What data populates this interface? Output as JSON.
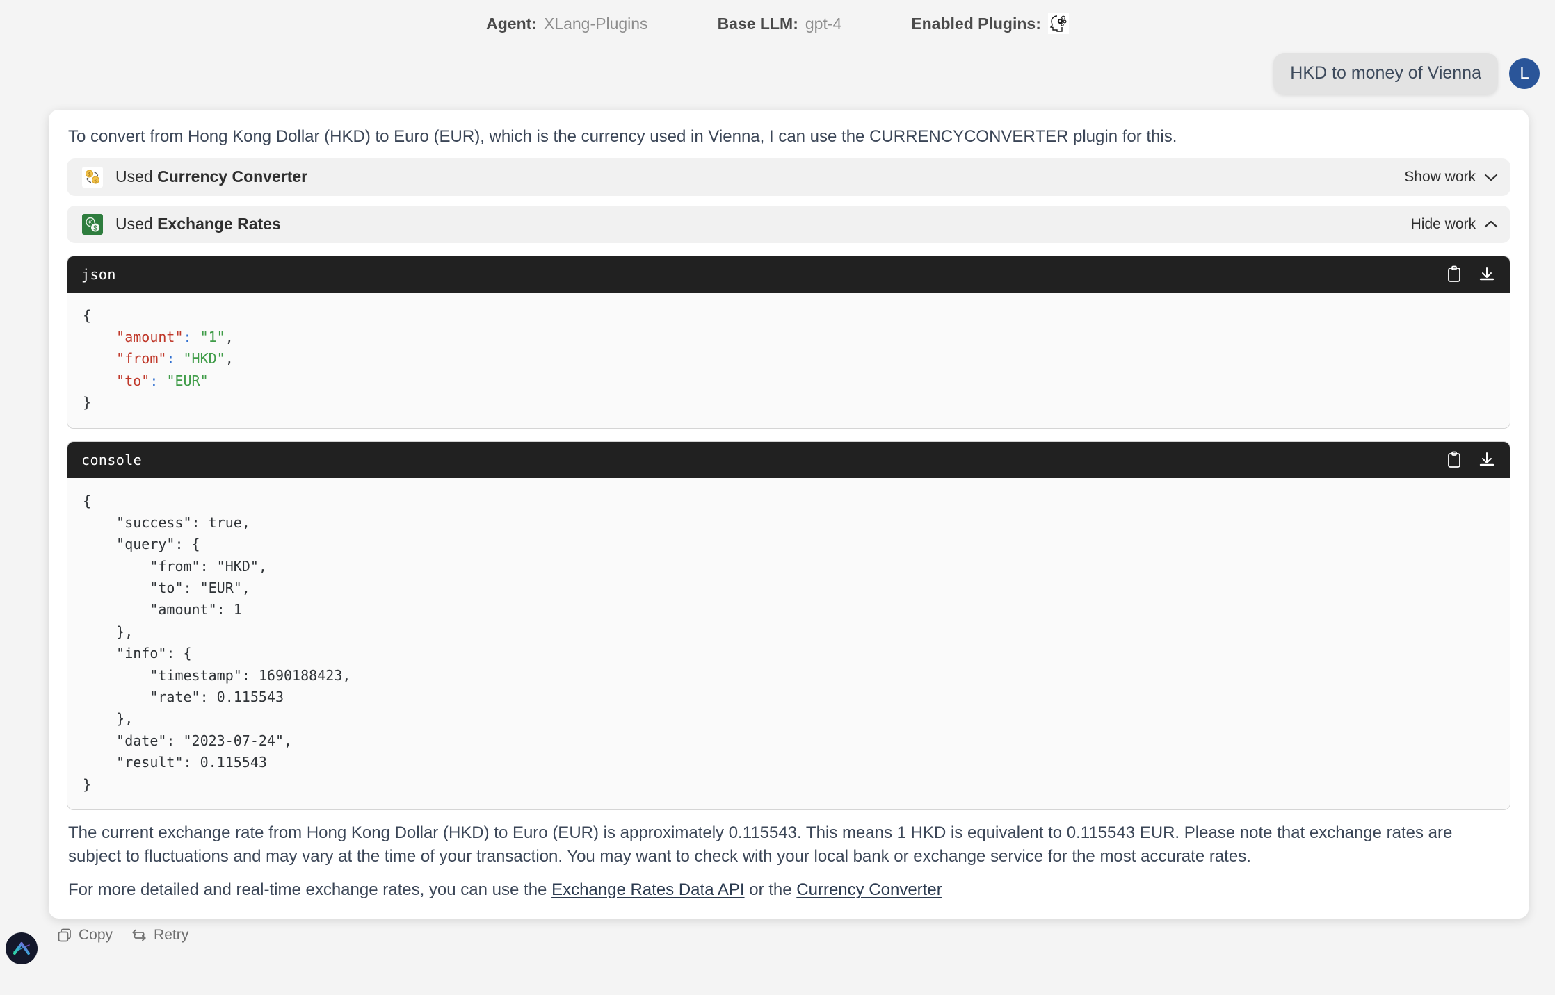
{
  "topbar": {
    "agent_label": "Agent:",
    "agent_value": "XLang-Plugins",
    "llm_label": "Base LLM:",
    "llm_value": "gpt-4",
    "plugins_label": "Enabled Plugins:",
    "plugins_icon": "ai-head-gears-icon"
  },
  "user_message": {
    "text": "HKD to money of Vienna",
    "avatar_initial": "L"
  },
  "assistant": {
    "intro": "To convert from Hong Kong Dollar (HKD) to Euro (EUR), which is the currency used in Vienna, I can use the CURRENCYCONVERTER plugin for this.",
    "plugin_rows": [
      {
        "used_label": "Used",
        "name": "Currency Converter",
        "toggle_label": "Show work",
        "toggle_state": "collapsed",
        "icon": "currency-exchange-coins-icon"
      },
      {
        "used_label": "Used",
        "name": "Exchange Rates",
        "toggle_label": "Hide work",
        "toggle_state": "expanded",
        "icon": "exchange-rates-green-icon"
      }
    ],
    "code_blocks": [
      {
        "lang": "json",
        "copy_icon": "clipboard-icon",
        "download_icon": "download-icon",
        "lines": [
          "{",
          "    \"amount\": \"1\",",
          "    \"from\": \"HKD\",",
          "    \"to\": \"EUR\"",
          "}"
        ]
      },
      {
        "lang": "console",
        "copy_icon": "clipboard-icon",
        "download_icon": "download-icon",
        "text": "{\n    \"success\": true,\n    \"query\": {\n        \"from\": \"HKD\",\n        \"to\": \"EUR\",\n        \"amount\": 1\n    },\n    \"info\": {\n        \"timestamp\": 1690188423,\n        \"rate\": 0.115543\n    },\n    \"date\": \"2023-07-24\",\n    \"result\": 0.115543\n}"
      }
    ],
    "summary": "The current exchange rate from Hong Kong Dollar (HKD) to Euro (EUR) is approximately 0.115543. This means 1 HKD is equivalent to 0.115543 EUR. Please note that exchange rates are subject to fluctuations and may vary at the time of your transaction. You may want to check with your local bank or exchange service for the most accurate rates.",
    "links_line": {
      "prefix": "For more detailed and real-time exchange rates, you can use the ",
      "link1": "Exchange Rates Data API",
      "middle": " or the ",
      "link2": "Currency Converter"
    }
  },
  "footer": {
    "copy_label": "Copy",
    "copy_icon": "copy-icon",
    "retry_label": "Retry",
    "retry_icon": "retry-icon",
    "logo_icon": "app-logo-icon"
  },
  "colors": {
    "user_bubble": "#e3e3e3",
    "avatar": "#2a5599",
    "code_header": "#212121",
    "json_key": "#c0392b",
    "json_string": "#3f9c48",
    "text": "#3b4657",
    "plugin_row": "#f1f1f1",
    "exchange_green": "#2e7d3e"
  }
}
